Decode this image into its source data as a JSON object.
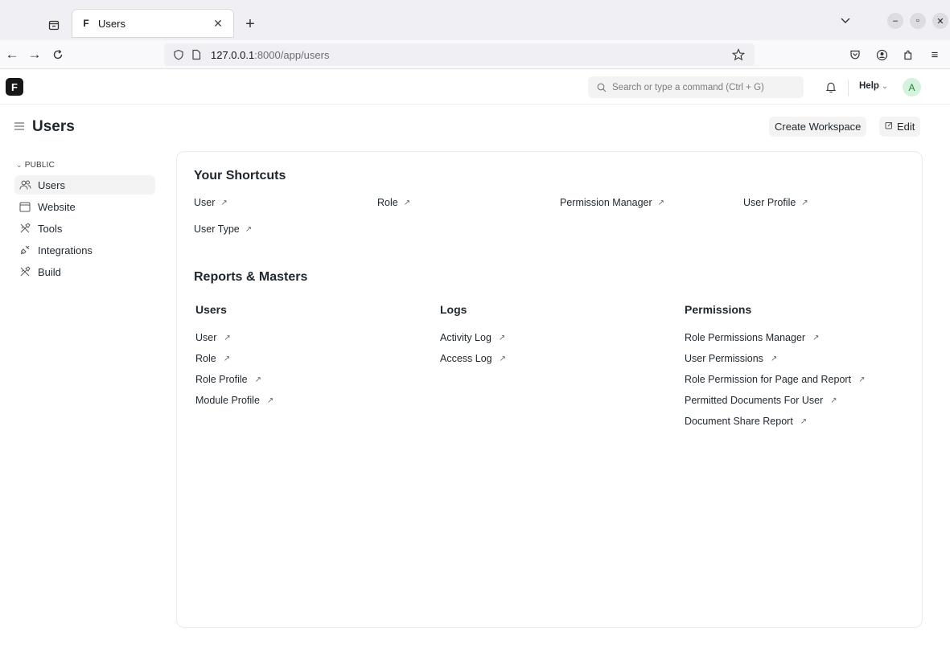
{
  "browser": {
    "tab": {
      "title": "Users",
      "favicon": "F"
    },
    "url": {
      "host": "127.0.0.1",
      "rest": ":8000/app/users"
    },
    "icons": [
      "tab-list-icon",
      "back-icon",
      "forward-icon",
      "reload-icon",
      "shield-icon",
      "page-icon",
      "star-icon",
      "pocket-icon",
      "account-icon",
      "extensions-icon",
      "menu-icon"
    ]
  },
  "header": {
    "logo": "F",
    "search_placeholder": "Search or type a command (Ctrl + G)",
    "help_label": "Help",
    "avatar_initial": "A"
  },
  "page": {
    "title": "Users",
    "create_workspace_label": "Create Workspace",
    "edit_label": "Edit"
  },
  "sidebar": {
    "section": "PUBLIC",
    "items": [
      {
        "label": "Users",
        "icon": "users-icon",
        "active": true
      },
      {
        "label": "Website",
        "icon": "browser-icon",
        "active": false
      },
      {
        "label": "Tools",
        "icon": "tools-icon",
        "active": false
      },
      {
        "label": "Integrations",
        "icon": "integrations-icon",
        "active": false
      },
      {
        "label": "Build",
        "icon": "build-icon",
        "active": false
      }
    ]
  },
  "shortcuts": {
    "title": "Your Shortcuts",
    "items": [
      "User",
      "Role",
      "Permission Manager",
      "User Profile",
      "User Type"
    ]
  },
  "reports": {
    "title": "Reports & Masters",
    "columns": [
      {
        "heading": "Users",
        "links": [
          "User",
          "Role",
          "Role Profile",
          "Module Profile"
        ]
      },
      {
        "heading": "Logs",
        "links": [
          "Activity Log",
          "Access Log"
        ]
      },
      {
        "heading": "Permissions",
        "links": [
          "Role Permissions Manager",
          "User Permissions",
          "Role Permission for Page and Report",
          "Permitted Documents For User",
          "Document Share Report"
        ]
      }
    ]
  },
  "arrow_glyph": "↗"
}
